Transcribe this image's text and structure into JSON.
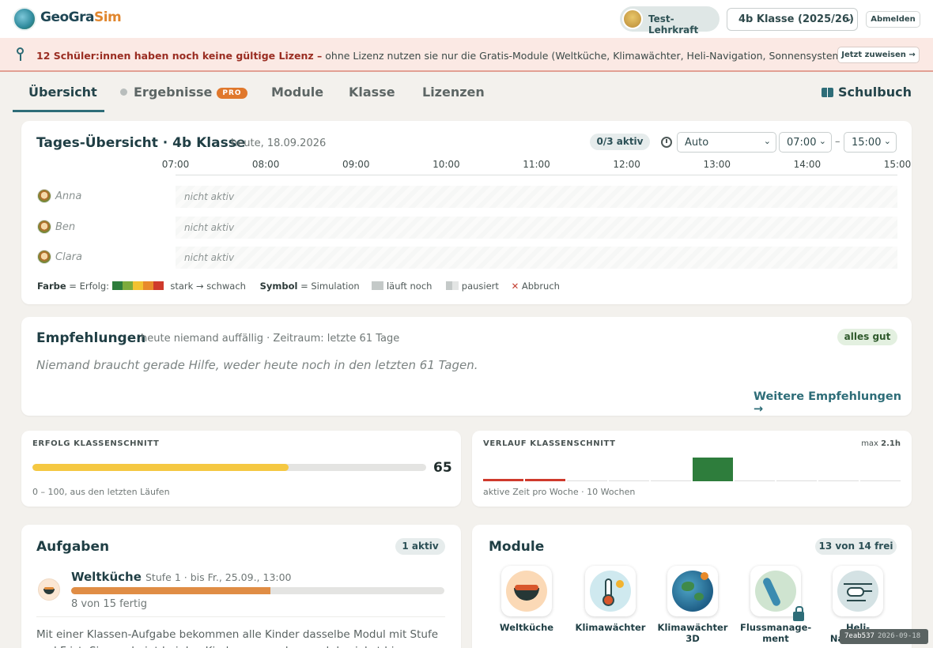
{
  "app": {
    "logo_part1": "GeoGra",
    "logo_part2": "Sim"
  },
  "header": {
    "user_name": "Test-Lehrkraft",
    "class_select": "4b Klasse (2025/26)",
    "logout_label": "Abmelden"
  },
  "banner": {
    "bold": "12 Schüler:innen haben noch keine gültige Lizenz –",
    "text": " ohne Lizenz nutzen sie nur die Gratis-Module (Weltküche, Klimawächter, Heli-Navigation, Sonnensystem).",
    "button": "Jetzt zuweisen →"
  },
  "tabs": {
    "overview": "Übersicht",
    "results": "Ergebnisse",
    "results_badge": "PRO",
    "modules": "Module",
    "class": "Klasse",
    "licenses": "Lizenzen",
    "schoolbook": "Schulbuch"
  },
  "daily": {
    "title": "Tages-Übersicht · 4b Klasse",
    "date": "heute, 18.09.2026",
    "active_badge": "0/3 aktiv",
    "mode": "Auto",
    "from": "07:00",
    "dash": "–",
    "to": "15:00",
    "times": [
      "07:00",
      "08:00",
      "09:00",
      "10:00",
      "11:00",
      "12:00",
      "13:00",
      "14:00",
      "15:00"
    ],
    "students": [
      {
        "name": "Anna",
        "status": "nicht aktiv"
      },
      {
        "name": "Ben",
        "status": "nicht aktiv"
      },
      {
        "name": "Clara",
        "status": "nicht aktiv"
      }
    ],
    "legend": {
      "color_label": "Farbe",
      "color_text": " = Erfolg: ",
      "scale_colors": [
        "#2e7d3c",
        "#7dab3c",
        "#f2c230",
        "#e88a2a",
        "#cf3a2c"
      ],
      "scale_text": "stark → schwach",
      "symbol_label": "Symbol",
      "symbol_text": " = Simulation",
      "running": "läuft noch",
      "paused": "pausiert",
      "abort": "Abbruch"
    }
  },
  "recommendations": {
    "title": "Empfehlungen",
    "subtitle": "heute niemand auffällig · Zeitraum: letzte 61 Tage",
    "badge": "alles gut",
    "text": "Niemand braucht gerade Hilfe, weder heute noch in den letzten 61 Tagen.",
    "more_link": "Weitere Empfehlungen →"
  },
  "success": {
    "title": "ERFOLG KLASSENSCHNITT",
    "value": "65",
    "fraction": 0.65,
    "caption": "0 – 100, aus den letzten Läufen"
  },
  "trend": {
    "title": "VERLAUF KLASSENSCHNITT",
    "max_prefix": "max ",
    "max_value": "2.1h",
    "caption": "aktive Zeit pro Woche · 10 Wochen",
    "weeks": [
      0.05,
      0.05,
      0,
      0,
      0,
      2.1,
      0,
      0,
      0,
      0
    ],
    "week_colors": [
      "#cf3a2c",
      "#cf3a2c",
      "#ddd",
      "#ddd",
      "#ddd",
      "#2e7d3c",
      "#ddd",
      "#ddd",
      "#ddd",
      "#ddd"
    ]
  },
  "tasks": {
    "title": "Aufgaben",
    "badge": "1 aktiv",
    "item_name": "Weltküche",
    "item_meta": "Stufe 1 · bis Fr., 25.09., 13:00",
    "progress_text": "8 von 15 fertig",
    "progress": 0.533,
    "info": "Mit einer Klassen-Aufgabe bekommen alle Kinder dasselbe Modul mit Stufe und Frist. Sie erscheint bei den Kindern ganz oben und du siehst hier, was schon fertig ist."
  },
  "modules": {
    "title": "Module",
    "badge": "13 von 14 frei",
    "items": [
      {
        "line1": "Weltküche",
        "line2": ""
      },
      {
        "line1": "Klimawächter",
        "line2": ""
      },
      {
        "line1": "Klimawächter",
        "line2": "3D"
      },
      {
        "line1": "Flussmanage-",
        "line2": "ment"
      },
      {
        "line1": "Heli-Navigation",
        "line2": ""
      }
    ]
  },
  "build": {
    "hash": "7eab537",
    "date": "2026-09-18"
  }
}
